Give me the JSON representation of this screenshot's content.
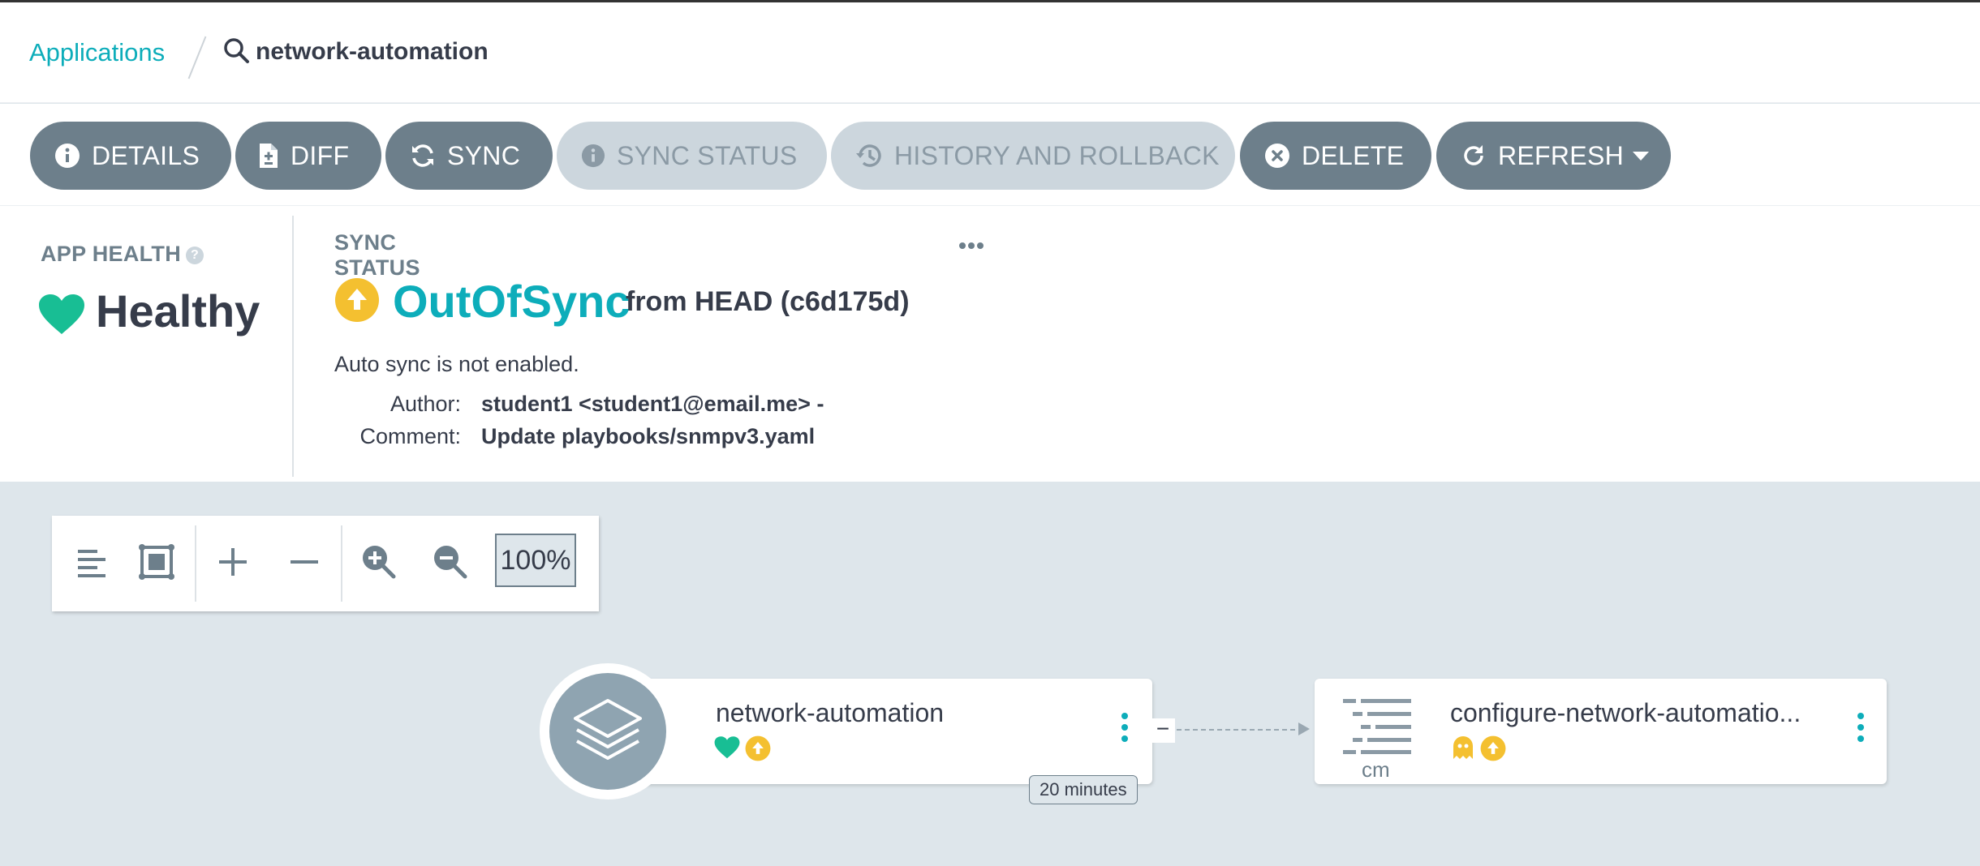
{
  "breadcrumb": {
    "applications_link": "Applications",
    "current": "network-automation",
    "search_icon": "search-icon"
  },
  "toolbar": {
    "details": "DETAILS",
    "diff": "DIFF",
    "sync": "SYNC",
    "sync_status": "SYNC STATUS",
    "history": "HISTORY AND ROLLBACK",
    "delete": "DELETE",
    "refresh": "REFRESH"
  },
  "app_health": {
    "title": "APP HEALTH",
    "status": "Healthy",
    "color": "#18be94"
  },
  "sync_status": {
    "title": "SYNC STATUS",
    "status": "OutOfSync",
    "revision": "from HEAD (c6d175d)",
    "auto_sync": "Auto sync is not enabled.",
    "author_label": "Author:",
    "author": "student1 <student1@email.me> -",
    "comment_label": "Comment:",
    "comment": "Update playbooks/snmpv3.yaml",
    "color": "#0dadba",
    "warn_color": "#f4c030"
  },
  "zoom": {
    "level": "100%"
  },
  "graph": {
    "app_node": {
      "name": "network-automation",
      "age": "20 minutes"
    },
    "resource_node": {
      "name": "configure-network-automatio...",
      "kind": "cm"
    }
  }
}
